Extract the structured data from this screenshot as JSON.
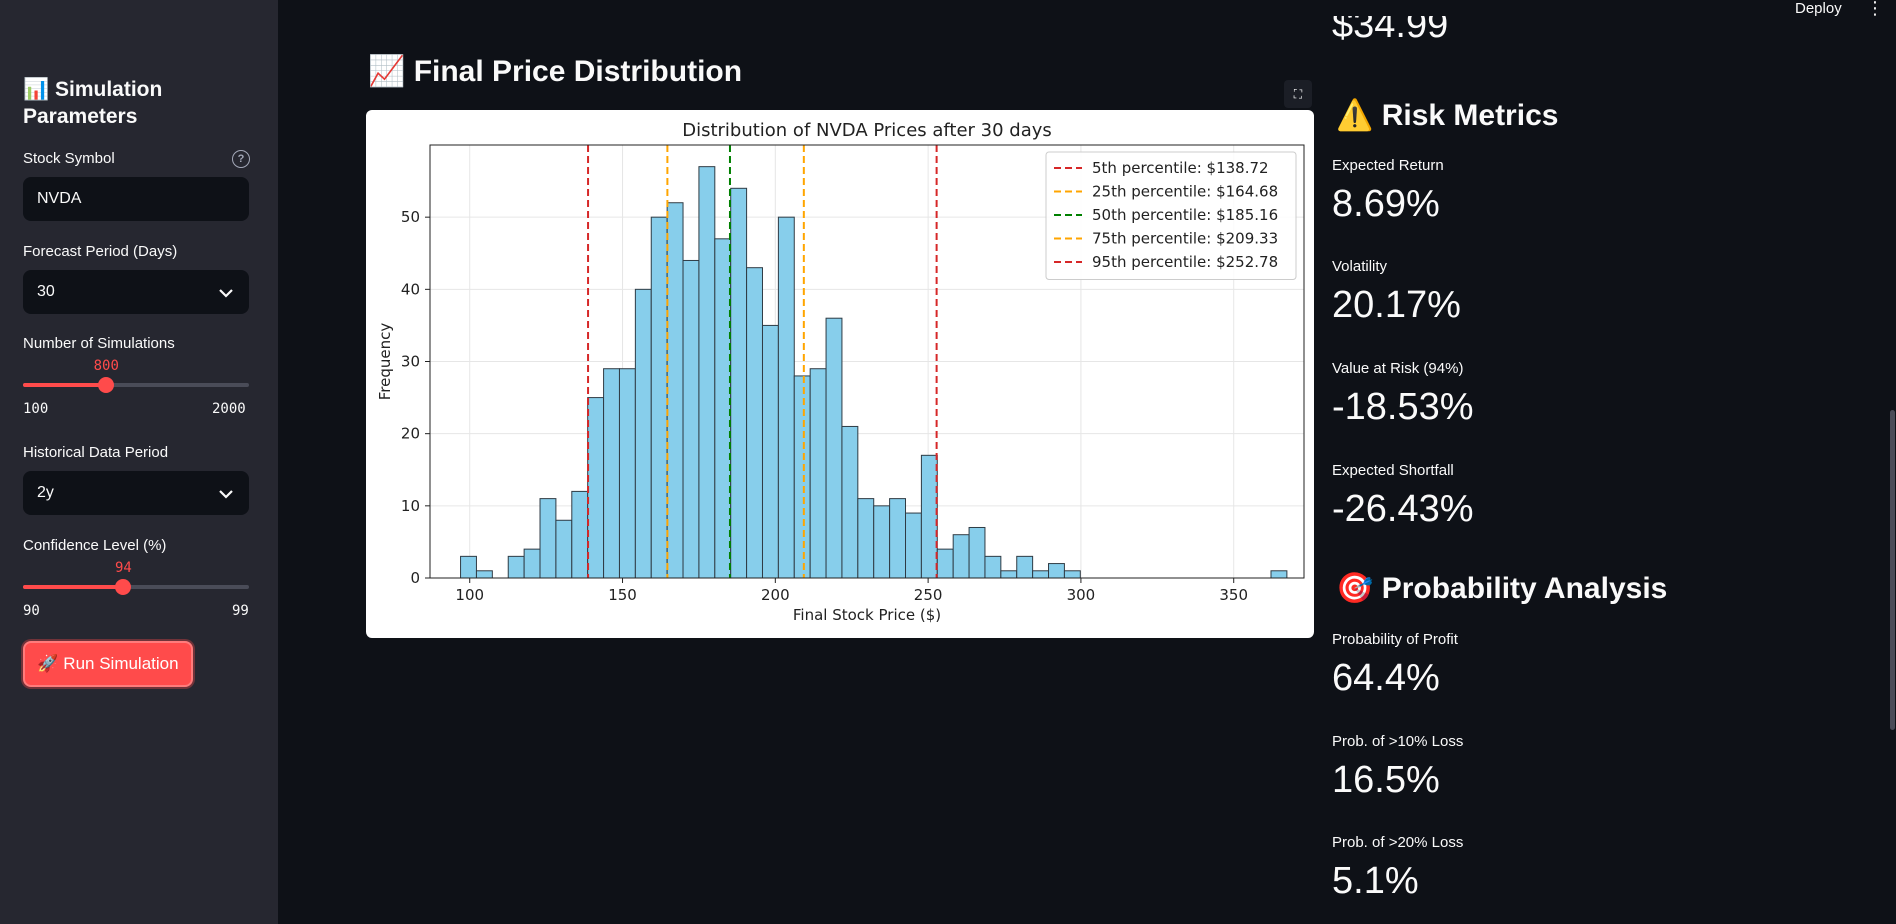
{
  "sidebar": {
    "title": "📊 Simulation Parameters",
    "stock_symbol": {
      "label": "Stock Symbol",
      "value": "NVDA"
    },
    "forecast_period": {
      "label": "Forecast Period (Days)",
      "value": "30"
    },
    "num_simulations": {
      "label": "Number of Simulations",
      "value": "800",
      "min": "100",
      "max": "2000",
      "fraction": 0.3684
    },
    "historical_period": {
      "label": "Historical Data Period",
      "value": "2y"
    },
    "confidence": {
      "label": "Confidence Level (%)",
      "value": "94",
      "min": "90",
      "max": "99",
      "fraction": 0.4444
    },
    "run_button": "🚀 Run Simulation"
  },
  "header": {
    "deploy_label": "Deploy",
    "menu_icon": "more-vertical-icon"
  },
  "main": {
    "title": "📈 Final Price Distribution"
  },
  "chart_data": {
    "type": "bar",
    "title": "Distribution of NVDA Prices after 30 days",
    "xlabel": "Final Stock Price ($)",
    "ylabel": "Frequency",
    "xlim": [
      87,
      373
    ],
    "ylim": [
      0,
      60
    ],
    "xticks": [
      100,
      150,
      200,
      250,
      300,
      350
    ],
    "yticks": [
      0,
      10,
      20,
      30,
      40,
      50
    ],
    "grid": true,
    "legend_position": "top-right",
    "bin_start": 97.0,
    "bin_width": 5.2,
    "values": [
      3,
      1,
      0,
      3,
      4,
      11,
      8,
      12,
      25,
      29,
      29,
      40,
      50,
      52,
      44,
      57,
      47,
      54,
      43,
      35,
      50,
      28,
      29,
      36,
      21,
      11,
      10,
      11,
      9,
      17,
      4,
      6,
      7,
      3,
      1,
      3,
      1,
      2,
      1,
      0,
      0,
      0,
      0,
      0,
      0,
      0,
      0,
      0,
      0,
      0,
      0,
      1
    ],
    "bar_color": "#87ceeb",
    "percentiles": [
      {
        "label": "5th percentile: $138.72",
        "value": 138.72,
        "color": "#d62728"
      },
      {
        "label": "25th percentile: $164.68",
        "value": 164.68,
        "color": "#ffa500"
      },
      {
        "label": "50th percentile: $185.16",
        "value": 185.16,
        "color": "#008000"
      },
      {
        "label": "75th percentile: $209.33",
        "value": 209.33,
        "color": "#ffa500"
      },
      {
        "label": "95th percentile: $252.78",
        "value": 252.78,
        "color": "#d62728"
      }
    ]
  },
  "right_panel": {
    "cut_value": "$34.99",
    "risk_title": "⚠️ Risk Metrics",
    "risk_metrics": [
      {
        "label": "Expected Return",
        "value": "8.69%"
      },
      {
        "label": "Volatility",
        "value": "20.17%"
      },
      {
        "label": "Value at Risk (94%)",
        "value": "-18.53%"
      },
      {
        "label": "Expected Shortfall",
        "value": "-26.43%"
      }
    ],
    "prob_title": "🎯 Probability Analysis",
    "prob_metrics": [
      {
        "label": "Probability of Profit",
        "value": "64.4%"
      },
      {
        "label": "Prob. of >10% Loss",
        "value": "16.5%"
      },
      {
        "label": "Prob. of >20% Loss",
        "value": "5.1%"
      }
    ]
  },
  "colors": {
    "accent": "#ff4b4b",
    "background": "#0e1117",
    "sidebar": "#262730"
  }
}
